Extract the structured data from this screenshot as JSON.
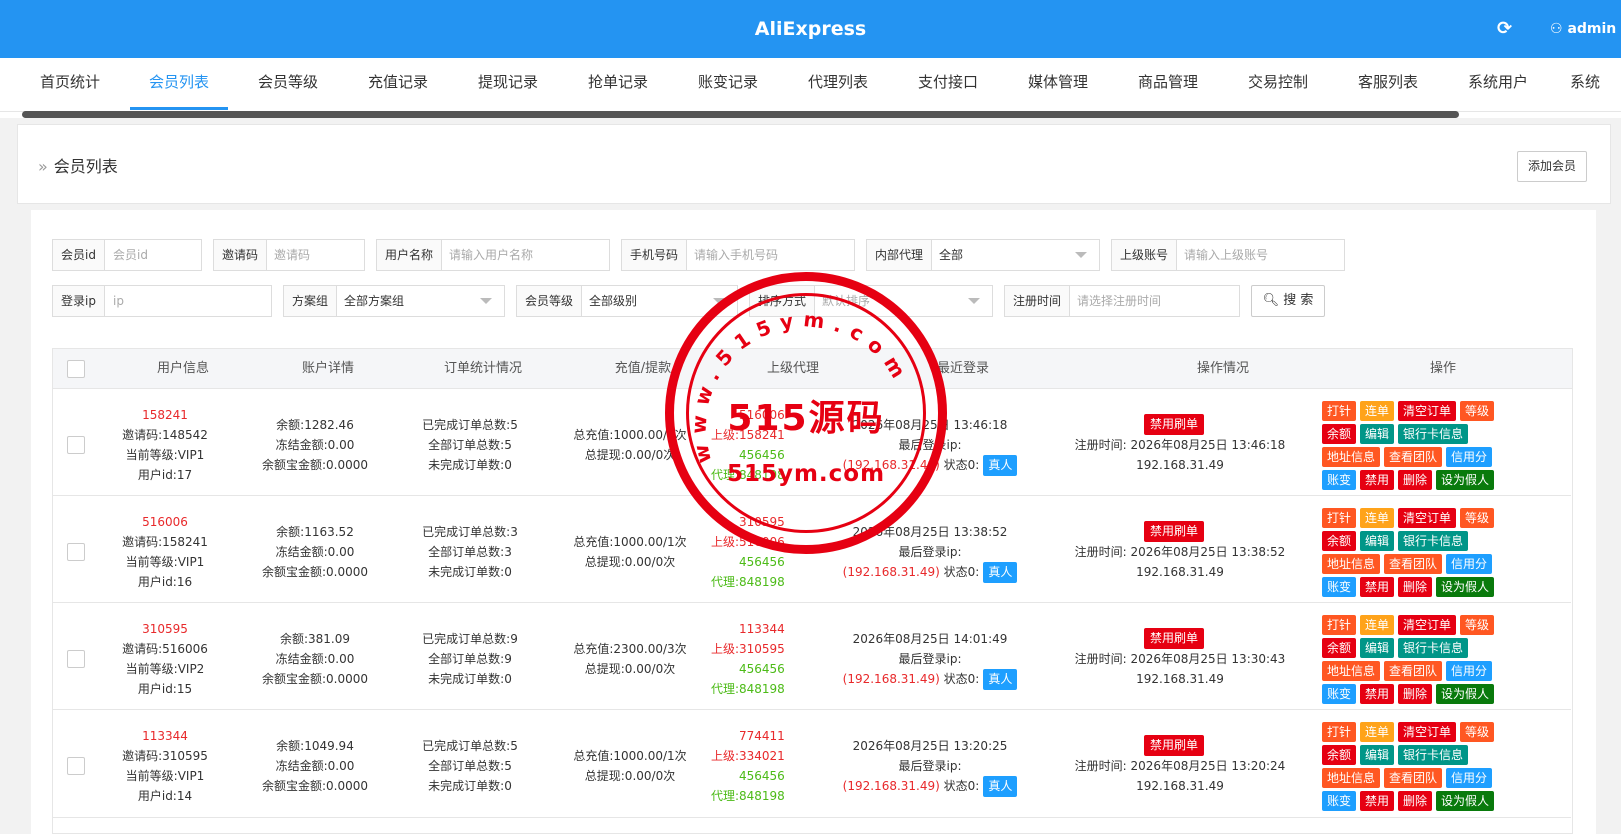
{
  "app": {
    "title": "AliExpress",
    "user": "admin"
  },
  "nav": {
    "tabs": [
      "首页统计",
      "会员列表",
      "会员等级",
      "充值记录",
      "提现记录",
      "抢单记录",
      "账变记录",
      "代理列表",
      "支付接口",
      "媒体管理",
      "商品管理",
      "交易控制",
      "客服列表",
      "系统用户",
      "系统"
    ],
    "active": 1
  },
  "page": {
    "title": "会员列表",
    "add_button": "添加会员"
  },
  "filters": {
    "member_id": {
      "label": "会员id",
      "placeholder": "会员id"
    },
    "invite_code": {
      "label": "邀请码",
      "placeholder": "邀请码"
    },
    "username": {
      "label": "用户名称",
      "placeholder": "请输入用户名称"
    },
    "phone": {
      "label": "手机号码",
      "placeholder": "请输入手机号码"
    },
    "internal_agent": {
      "label": "内部代理",
      "value": "全部"
    },
    "parent_account": {
      "label": "上级账号",
      "placeholder": "请输入上级账号"
    },
    "login_ip": {
      "label": "登录ip",
      "placeholder": "ip"
    },
    "plan_group": {
      "label": "方案组",
      "value": "全部方案组"
    },
    "member_level": {
      "label": "会员等级",
      "value": "全部级别"
    },
    "sort": {
      "label": "排序方式",
      "value": "默认排序"
    },
    "register_time": {
      "label": "注册时间",
      "placeholder": "请选择注册时间"
    },
    "search_button": "搜 索"
  },
  "table": {
    "headers": [
      "用户信息",
      "账户详情",
      "订单统计情况",
      "充值/提款",
      "上级代理",
      "最近登录",
      "操作情况",
      "操作"
    ],
    "rows": [
      {
        "uid": "158241",
        "invite": "邀请码:148542",
        "level": "当前等级:VIP1",
        "userid": "用户id:17",
        "balance": "余额:1282.46",
        "frozen": "冻结金额:0.00",
        "yuebao": "余额宝金额:0.0000",
        "done": "已完成订单总数:5",
        "total": "全部订单总数:5",
        "undone": "未完成订单数:0",
        "recharge": "总充值:1000.00/1次",
        "withdraw": "总提现:0.00/0次",
        "up1": "516006",
        "up2": "158241",
        "ag1": "456456",
        "ag2": "848198",
        "last_login": "2026年08月25日 13:46:18",
        "last_ip_label": "最后登录ip:",
        "ip": "(192.168.31.49)",
        "state": "状态0:",
        "real": "真人",
        "ban": "禁用刷单",
        "reg_time": "注册时间: 2026年08月25日 13:46:18",
        "reg_ip": "192.168.31.49"
      },
      {
        "uid": "516006",
        "invite": "邀请码:158241",
        "level": "当前等级:VIP1",
        "userid": "用户id:16",
        "balance": "余额:1163.52",
        "frozen": "冻结金额:0.00",
        "yuebao": "余额宝金额:0.0000",
        "done": "已完成订单总数:3",
        "total": "全部订单总数:3",
        "undone": "未完成订单数:0",
        "recharge": "总充值:1000.00/1次",
        "withdraw": "总提现:0.00/0次",
        "up1": "310595",
        "up2": "516006",
        "ag1": "456456",
        "ag2": "848198",
        "last_login": "2026年08月25日 13:38:52",
        "last_ip_label": "最后登录ip:",
        "ip": "(192.168.31.49)",
        "state": "状态0:",
        "real": "真人",
        "ban": "禁用刷单",
        "reg_time": "注册时间: 2026年08月25日 13:38:52",
        "reg_ip": "192.168.31.49"
      },
      {
        "uid": "310595",
        "invite": "邀请码:516006",
        "level": "当前等级:VIP2",
        "userid": "用户id:15",
        "balance": "余额:381.09",
        "frozen": "冻结金额:0.00",
        "yuebao": "余额宝金额:0.0000",
        "done": "已完成订单总数:9",
        "total": "全部订单总数:9",
        "undone": "未完成订单数:0",
        "recharge": "总充值:2300.00/3次",
        "withdraw": "总提现:0.00/0次",
        "up1": "113344",
        "up2": "310595",
        "ag1": "456456",
        "ag2": "848198",
        "last_login": "2026年08月25日 14:01:49",
        "last_ip_label": "最后登录ip:",
        "ip": "(192.168.31.49)",
        "state": "状态0:",
        "real": "真人",
        "ban": "禁用刷单",
        "reg_time": "注册时间: 2026年08月25日 13:30:43",
        "reg_ip": "192.168.31.49"
      },
      {
        "uid": "113344",
        "invite": "邀请码:310595",
        "level": "当前等级:VIP1",
        "userid": "用户id:14",
        "balance": "余额:1049.94",
        "frozen": "冻结金额:0.00",
        "yuebao": "余额宝金额:0.0000",
        "done": "已完成订单总数:5",
        "total": "全部订单总数:5",
        "undone": "未完成订单数:0",
        "recharge": "总充值:1000.00/1次",
        "withdraw": "总提现:0.00/0次",
        "up1": "774411",
        "up2": "334021",
        "ag1": "456456",
        "ag2": "848198",
        "last_login": "2026年08月25日 13:20:25",
        "last_ip_label": "最后登录ip:",
        "ip": "(192.168.31.49)",
        "state": "状态0:",
        "real": "真人",
        "ban": "禁用刷单",
        "reg_time": "注册时间: 2026年08月25日 13:20:24",
        "reg_ip": "192.168.31.49"
      }
    ],
    "labels": {
      "upper": "上级:",
      "agent": "代理:"
    },
    "ops": {
      "row1": [
        "打针",
        "连单",
        "清空订单",
        "等级"
      ],
      "row2": [
        "余额",
        "编辑",
        "银行卡信息"
      ],
      "row3": [
        "地址信息",
        "查看团队",
        "信用分"
      ],
      "row4": [
        "账变",
        "禁用",
        "删除",
        "设为假人"
      ]
    }
  },
  "watermark": {
    "big": "515源码",
    "small": "515ym.com",
    "arc": "www.515ym.com"
  },
  "colors": {
    "header": "#2494f2",
    "red_tag": "#e60012",
    "orange_tag": "#ff5722",
    "yellow_tag": "#ffa31a",
    "green_tag": "#009688",
    "blue_tag": "#1e9fff",
    "dark_green_tag": "#097a0c"
  }
}
